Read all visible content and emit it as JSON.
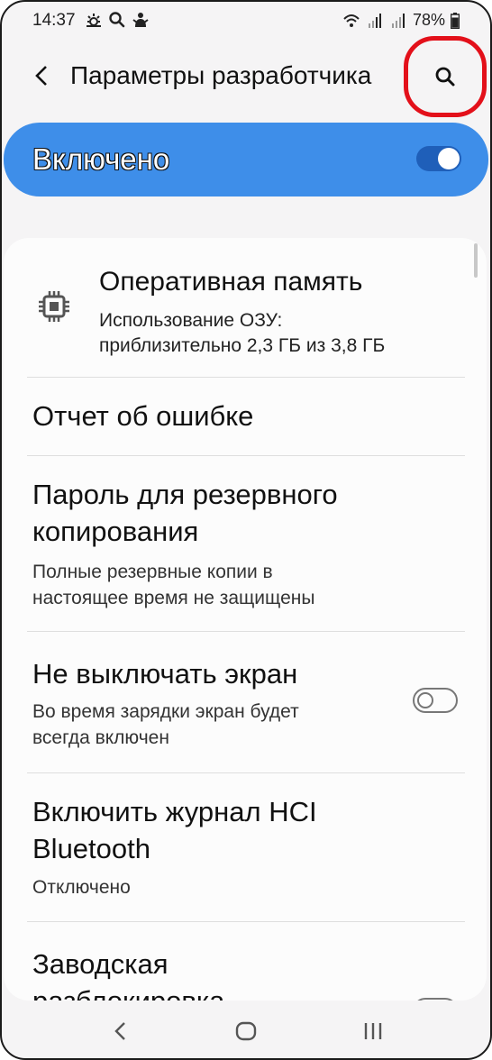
{
  "status_bar": {
    "time": "14:37",
    "battery": "78%",
    "left_icons": [
      "weather-icon",
      "search-icon",
      "notification-icon"
    ],
    "right_icons": [
      "wifi-icon",
      "signal-icon",
      "signal-icon",
      "battery-icon"
    ]
  },
  "header": {
    "title": "Параметры разработчика",
    "back_icon": "back-arrow-icon",
    "search_icon": "search-icon",
    "highlight_color": "#e3101a"
  },
  "master_switch": {
    "label": "Включено",
    "state": "on",
    "color": "#3e8ee9"
  },
  "settings": {
    "ram": {
      "title": "Оперативная память",
      "subtitle_line1": "Использование ОЗУ:",
      "subtitle_line2": "приблизительно 2,3 ГБ из 3,8 ГБ",
      "icon": "memory-chip-icon"
    },
    "bug_report": {
      "title": "Отчет об ошибке"
    },
    "backup_password": {
      "title_line1": "Пароль для резервного",
      "title_line2": "копирования",
      "subtitle_line1": "Полные резервные копии в",
      "subtitle_line2": "настоящее время не защищены"
    },
    "stay_awake": {
      "title": "Не выключать экран",
      "subtitle_line1": "Во время зарядки экран будет",
      "subtitle_line2": "всегда включен",
      "state": "off"
    },
    "hci_log": {
      "title_line1": "Включить журнал HCI",
      "title_line2": "Bluetooth",
      "subtitle": "Отключено"
    },
    "oem_unlock": {
      "title_line1": "Заводская",
      "title_line2": "разблокировка",
      "state": "off"
    }
  },
  "nav_bar": {
    "back_icon": "nav-back-icon",
    "home_icon": "nav-home-icon",
    "recents_icon": "nav-recents-icon"
  }
}
